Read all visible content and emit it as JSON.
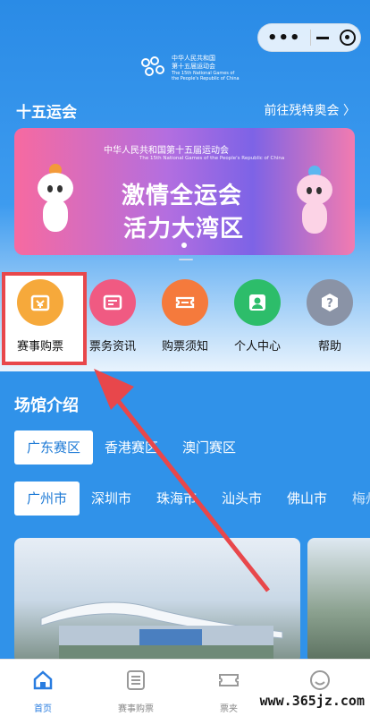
{
  "logo": {
    "line1": "中华人民共和国",
    "line2": "第十五届运动会",
    "line3": "The 15th National Games of",
    "line4": "the People's Republic of China"
  },
  "section": {
    "title": "十五运会",
    "link": "前往残特奥会 〉"
  },
  "banner": {
    "headline": "中华人民共和国第十五届运动会",
    "subline": "The 15th National Games of the People's Republic of China",
    "slogan1": "激情全运会",
    "slogan2": "活力大湾区"
  },
  "menu": {
    "items": [
      {
        "label": "赛事购票",
        "icon": "ticket-purchase-icon",
        "color": "#f6a93b"
      },
      {
        "label": "票务资讯",
        "icon": "ticket-info-icon",
        "color": "#f05a82"
      },
      {
        "label": "购票须知",
        "icon": "ticket-notice-icon",
        "color": "#f57a3c"
      },
      {
        "label": "个人中心",
        "icon": "user-icon",
        "color": "#2dbd6a"
      },
      {
        "label": "帮助",
        "icon": "help-icon",
        "color": "#8a93a6"
      }
    ]
  },
  "venue": {
    "title": "场馆介绍",
    "regions": [
      "广东赛区",
      "香港赛区",
      "澳门赛区"
    ],
    "cities": [
      "广州市",
      "深圳市",
      "珠海市",
      "汕头市",
      "佛山市",
      "梅州"
    ]
  },
  "tabbar": {
    "items": [
      "首页",
      "赛事购票",
      "票夹",
      ""
    ]
  },
  "watermark": "www.365jz.com",
  "colors": {
    "primary": "#2f8ee8",
    "highlight": "#e8474b",
    "active": "#2a7de0"
  }
}
